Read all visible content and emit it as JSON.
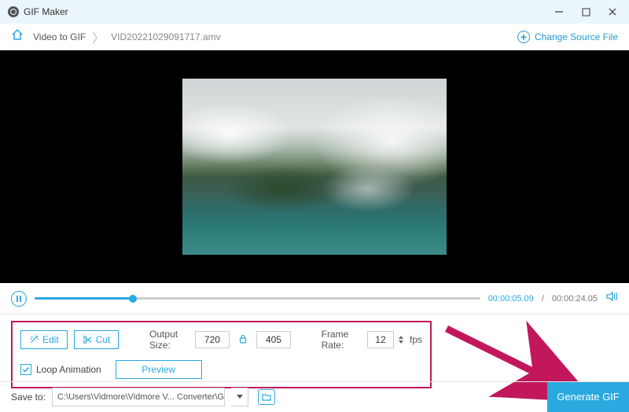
{
  "window": {
    "title": "GIF Maker"
  },
  "breadcrumb": {
    "root": "Video to GIF",
    "file": "VID20221029091717.amv",
    "change_source": "Change Source File"
  },
  "playback": {
    "current": "00:00:05.09",
    "total": "00:00:24.05"
  },
  "controls": {
    "edit_label": "Edit",
    "cut_label": "Cut",
    "output_size_label": "Output Size:",
    "width": "720",
    "height": "405",
    "frame_rate_label": "Frame Rate:",
    "fps_value": "12",
    "fps_unit": "fps",
    "loop_label": "Loop Animation",
    "preview_label": "Preview"
  },
  "save": {
    "label": "Save to:",
    "path": "C:\\Users\\Vidmore\\Vidmore V... Converter\\GIF Maker"
  },
  "generate": {
    "label": "Generate GIF"
  }
}
